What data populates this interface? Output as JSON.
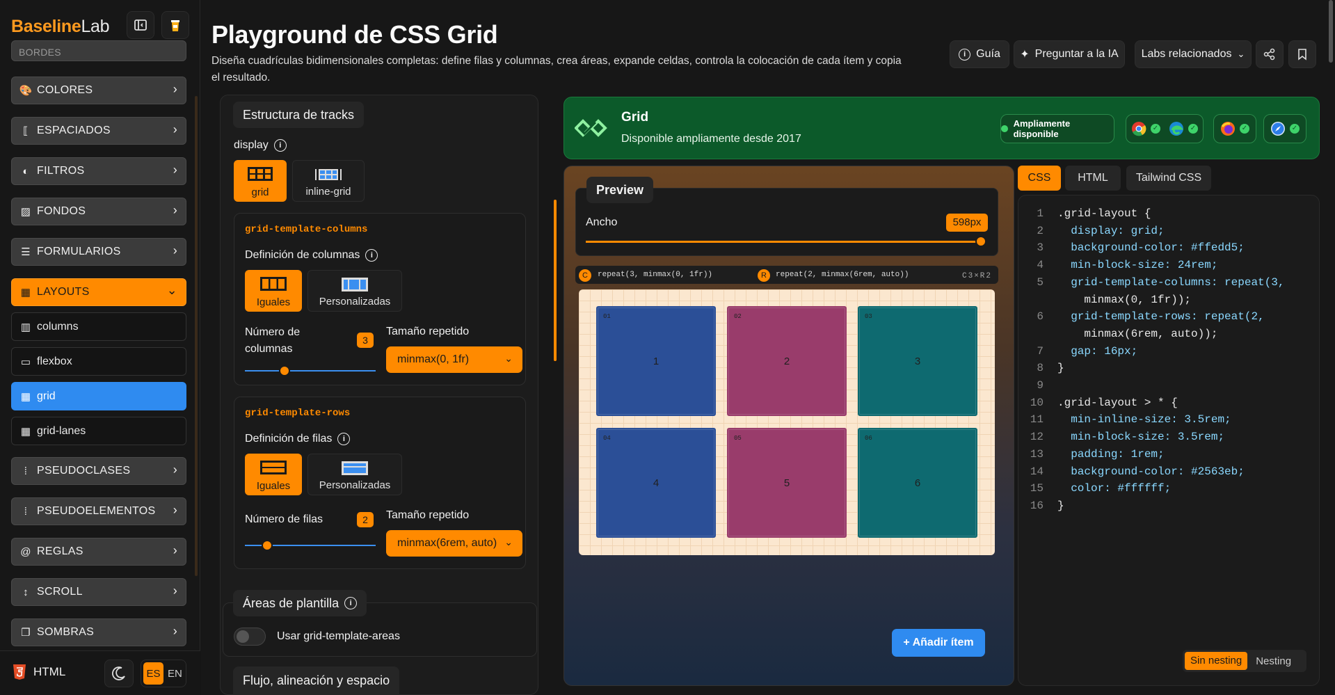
{
  "sidebar": {
    "logo_part1": "Baseline",
    "logo_part2": "Lab",
    "partial_top_label": "BORDES",
    "categories": [
      {
        "label": "COLORES",
        "icon": "palette-icon"
      },
      {
        "label": "ESPACIADOS",
        "icon": "spacing-icon"
      },
      {
        "label": "FILTROS",
        "icon": "filter-icon"
      },
      {
        "label": "FONDOS",
        "icon": "background-icon"
      },
      {
        "label": "FORMULARIOS",
        "icon": "form-icon"
      },
      {
        "label": "LAYOUTS",
        "icon": "layout-icon"
      },
      {
        "label": "PSEUDOCLASES",
        "icon": "pseudo-icon"
      },
      {
        "label": "PSEUDOELEMENTOS",
        "icon": "pseudo-element-icon"
      },
      {
        "label": "REGLAS",
        "icon": "at-icon"
      },
      {
        "label": "SCROLL",
        "icon": "scroll-icon"
      },
      {
        "label": "SOMBRAS",
        "icon": "shadow-icon"
      }
    ],
    "layout_items": [
      "columns",
      "flexbox",
      "grid",
      "grid-lanes"
    ],
    "bottom_html": "HTML",
    "lang_es": "ES",
    "lang_en": "EN"
  },
  "header": {
    "title": "Playground de CSS Grid",
    "description": "Diseña cuadrículas bidimensionales completas: define filas y columnas, crea áreas, expande celdas, controla la colocación de cada ítem y copia el resultado.",
    "btn_guide": "Guía",
    "btn_ask_ai": "Preguntar a la IA",
    "btn_related": "Labs relacionados"
  },
  "tracks": {
    "heading": "Estructura de tracks",
    "display_label": "display",
    "display_grid": "grid",
    "display_inline_grid": "inline-grid",
    "columns_title": "grid-template-columns",
    "columns_def_label": "Definición de columnas",
    "columns_equal": "Iguales",
    "columns_custom": "Personalizadas",
    "columns_count_label": "Número de columnas",
    "columns_count": "3",
    "columns_repeat_label": "Tamaño repetido",
    "columns_repeat_value": "minmax(0, 1fr)",
    "rows_title": "grid-template-rows",
    "rows_def_label": "Definición de filas",
    "rows_equal": "Iguales",
    "rows_custom": "Personalizadas",
    "rows_count_label": "Número de filas",
    "rows_count": "2",
    "rows_repeat_label": "Tamaño repetido",
    "rows_repeat_value": "minmax(6rem, auto)",
    "areas_heading": "Áreas de plantilla",
    "areas_toggle_label": "Usar grid-template-areas",
    "flow_heading": "Flujo, alineación y espacio"
  },
  "baseline": {
    "feature": "Grid",
    "status": "Disponible ampliamente desde 2017",
    "badge": "Ampliamente disponible",
    "browsers": [
      "chrome-icon",
      "edge-icon",
      "firefox-icon",
      "safari-icon"
    ]
  },
  "preview": {
    "heading": "Preview",
    "width_label": "Ancho",
    "width_value": "598px",
    "width_fraction": 1.0,
    "col_badge": "C",
    "col_formula": "repeat(3, minmax(0, 1fr))",
    "row_badge": "R",
    "row_formula": "repeat(2, minmax(6rem, auto))",
    "dims": "C3×R2",
    "cells": [
      {
        "tag": "01",
        "label": "1",
        "color": "#2b4f97"
      },
      {
        "tag": "02",
        "label": "2",
        "color": "#993c6b"
      },
      {
        "tag": "03",
        "label": "3",
        "color": "#0e6a70"
      },
      {
        "tag": "04",
        "label": "4",
        "color": "#2b4f97"
      },
      {
        "tag": "05",
        "label": "5",
        "color": "#993c6b"
      },
      {
        "tag": "06",
        "label": "6",
        "color": "#0e6a70"
      }
    ],
    "add_item": "+ Añadir ítem"
  },
  "code": {
    "tabs": [
      "CSS",
      "HTML",
      "Tailwind CSS"
    ],
    "nesting_off": "Sin nesting",
    "nesting_on": "Nesting",
    "lines": [
      {
        "n": "1",
        "text": ".grid-layout {"
      },
      {
        "n": "2",
        "text": "  display: grid;"
      },
      {
        "n": "3",
        "text": "  background-color: #ffedd5;"
      },
      {
        "n": "4",
        "text": "  min-block-size: 24rem;"
      },
      {
        "n": "5",
        "text": "  grid-template-columns: repeat(3,"
      },
      {
        "n": "",
        "text": "    minmax(0, 1fr));"
      },
      {
        "n": "6",
        "text": "  grid-template-rows: repeat(2,"
      },
      {
        "n": "",
        "text": "    minmax(6rem, auto));"
      },
      {
        "n": "7",
        "text": "  gap: 16px;"
      },
      {
        "n": "8",
        "text": "}"
      },
      {
        "n": "9",
        "text": ""
      },
      {
        "n": "10",
        "text": ".grid-layout > * {"
      },
      {
        "n": "11",
        "text": "  min-inline-size: 3.5rem;"
      },
      {
        "n": "12",
        "text": "  min-block-size: 3.5rem;"
      },
      {
        "n": "13",
        "text": "  padding: 1rem;"
      },
      {
        "n": "14",
        "text": "  background-color: #2563eb;"
      },
      {
        "n": "15",
        "text": "  color: #ffffff;"
      },
      {
        "n": "16",
        "text": "}"
      }
    ]
  },
  "colors": {
    "accent": "#ff8a00",
    "selected": "#2f8bf0",
    "baseline_green": "#0c5a2a"
  }
}
